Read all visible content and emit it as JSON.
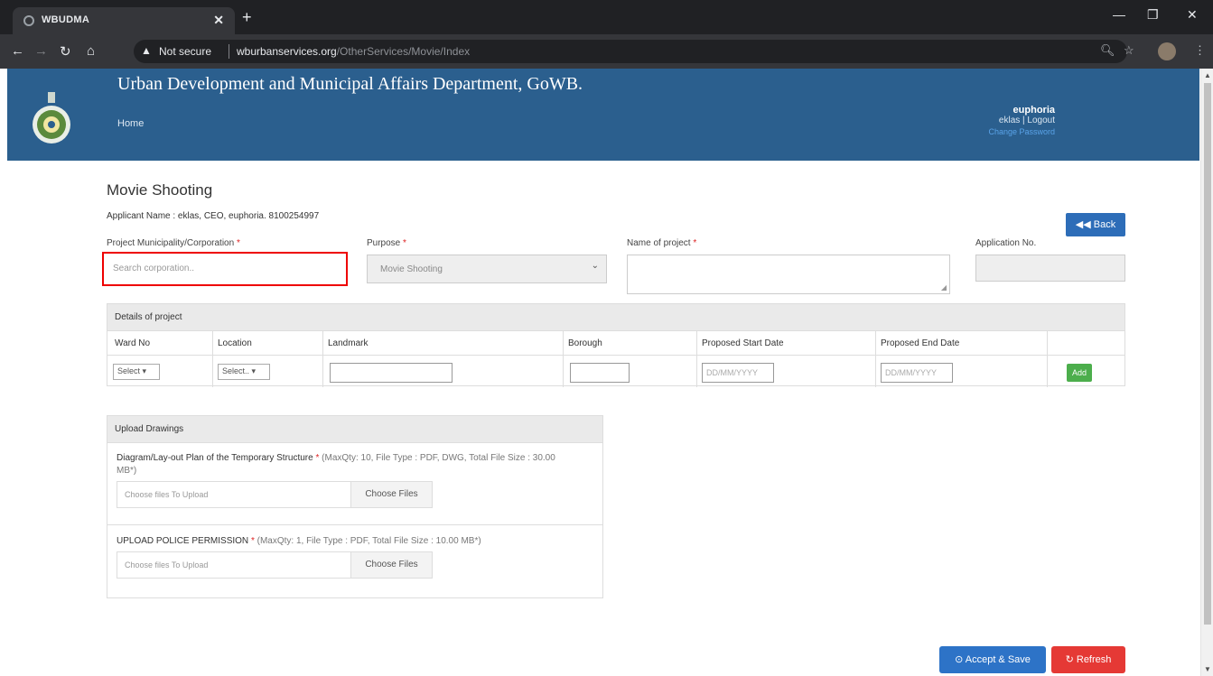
{
  "browser": {
    "tab_title": "WBUDMA",
    "security_label": "Not secure",
    "url_host": "wburbanservices.org",
    "url_path": "/OtherServices/Movie/Index"
  },
  "header": {
    "title": "Urban Development and Municipal Affairs Department, GoWB.",
    "home_link": "Home",
    "username": "euphoria",
    "user_links": "eklas | Logout",
    "extra_link": "Change Password"
  },
  "form": {
    "page_title": "Movie Shooting",
    "applicant": "Applicant Name : eklas, CEO, euphoria. 8100254997",
    "back_label": "Back",
    "municipality_label": "Project Municipality/Corporation",
    "municipality_placeholder": "Search corporation..",
    "purpose_label": "Purpose",
    "purpose_value": "Movie Shooting",
    "project_name_label": "Name of project",
    "application_no_label": "Application No.",
    "required_mark": "*"
  },
  "details": {
    "heading": "Details of project",
    "columns": [
      "Ward No",
      "Location",
      "Landmark",
      "Borough",
      "Proposed Start Date",
      "Proposed End Date"
    ],
    "ward_select": "Select",
    "location_select": "Select..",
    "date_placeholder": "DD/MM/YYYY",
    "add_label": "Add"
  },
  "uploads": {
    "heading": "Upload Drawings",
    "items": [
      {
        "label": "Diagram/Lay-out Plan of the Temporary Structure",
        "meta": "(MaxQty: 10, File Type : PDF, DWG, Total File Size : 30.00 MB*)",
        "placeholder": "Choose files To Upload",
        "button": "Choose Files"
      },
      {
        "label": "UPLOAD POLICE PERMISSION",
        "meta": "(MaxQty: 1, File Type : PDF, Total File Size : 10.00 MB*)",
        "placeholder": "Choose files To Upload",
        "button": "Choose Files"
      }
    ]
  },
  "actions": {
    "accept_label": "Accept & Save",
    "refresh_label": "Refresh"
  },
  "colors": {
    "header_bg": "#2b5f8e",
    "primary": "#2d73c7",
    "success": "#4cae4c",
    "danger": "#e53935",
    "highlight": "#ee0000"
  }
}
